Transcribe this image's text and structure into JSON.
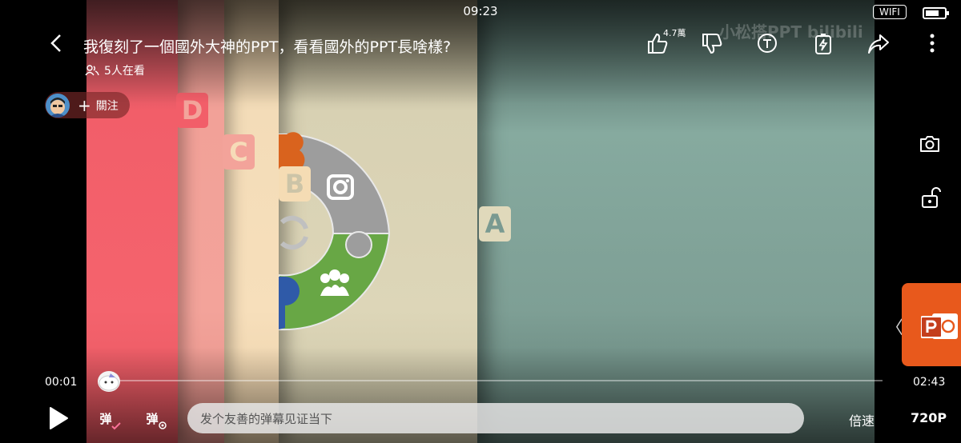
{
  "status_bar": {
    "time": "09:23",
    "network": "WIFI"
  },
  "video": {
    "title": "我復刻了一個國外大神的PPT，看看國外的PPT長啥樣?",
    "viewers": "5人在看",
    "follow_label": "關注",
    "watermark": "小松搭PPT  bilibili",
    "like_count": "4.7萬",
    "slide": {
      "tabs": [
        "A",
        "B",
        "C",
        "D"
      ]
    }
  },
  "player": {
    "current_time": "00:01",
    "total_time": "02:43",
    "progress": 0.006,
    "danmaku_placeholder": "发个友善的弹幕见证当下",
    "speed_label": "倍速",
    "quality_label": "720P",
    "danmaku_toggle_label": "弹",
    "danmaku_settings_label": "弹"
  },
  "colors": {
    "accent": "#fb7299",
    "powerpoint": "#e8591c"
  }
}
